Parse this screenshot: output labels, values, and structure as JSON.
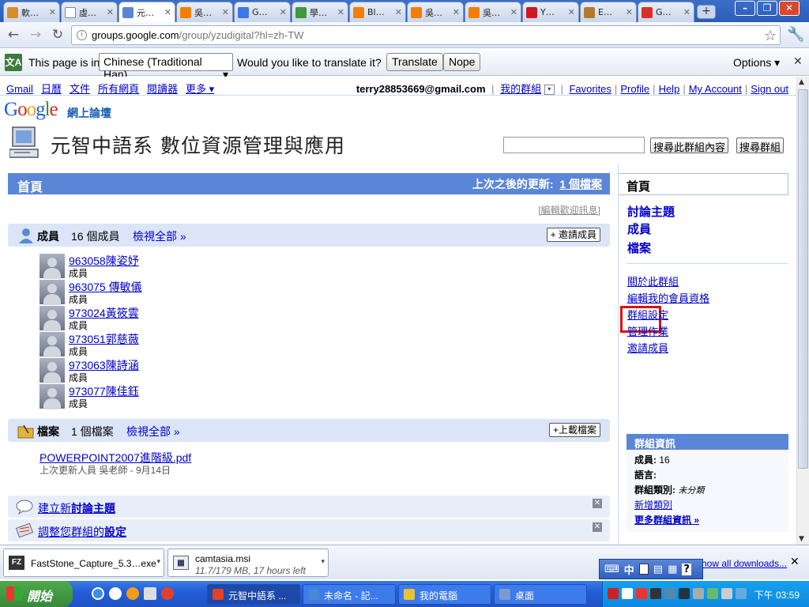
{
  "tabs": [
    {
      "label": "軟…",
      "favicon": "star-icon",
      "color": "#d98c2b"
    },
    {
      "label": "虛…",
      "favicon": "page-icon",
      "color": "#ffffff"
    },
    {
      "label": "元…",
      "favicon": "groups-icon",
      "color": "#5b86d7",
      "active": true
    },
    {
      "label": "吳…",
      "favicon": "blogger-icon",
      "color": "#f57d00"
    },
    {
      "label": "G…",
      "favicon": "google-docs-icon",
      "color": "#3b78e7"
    },
    {
      "label": "學…",
      "favicon": "spreadsheet-icon",
      "color": "#3b9a3b"
    },
    {
      "label": "Bl…",
      "favicon": "blogger-icon",
      "color": "#f57d00"
    },
    {
      "label": "吳…",
      "favicon": "blogger-icon",
      "color": "#f57d00"
    },
    {
      "label": "吳…",
      "favicon": "blogger-icon",
      "color": "#f57d00"
    },
    {
      "label": "Y…",
      "favicon": "youtube-icon",
      "color": "#cc181e"
    },
    {
      "label": "E…",
      "favicon": "bookmark-icon",
      "color": "#b07a2e"
    },
    {
      "label": "G…",
      "favicon": "gmail-icon",
      "color": "#d93025"
    }
  ],
  "url": {
    "host": "groups.google.com",
    "path": "/group/yzudigital?hl=zh-TW"
  },
  "translate": {
    "prefix": "This page is in",
    "language": "Chinese (Traditional Han)",
    "question": "Would you like to translate it?",
    "translate_label": "Translate",
    "nope_label": "Nope",
    "options_label": "Options ▾"
  },
  "gbar": {
    "left": [
      "Gmail",
      "日曆",
      "文件",
      "所有網頁",
      "閱讀器",
      "更多 ▾"
    ],
    "email": "terry28853669@gmail.com",
    "my_groups": "我的群組",
    "right": [
      "Favorites",
      "Profile",
      "Help",
      "My Account",
      "Sign out"
    ]
  },
  "logo_sub": "網上論壇",
  "group_title": "元智中語系 數位資源管理與應用",
  "search": {
    "in_group_label": "搜尋此群組內容",
    "groups_label": "搜尋群組"
  },
  "home": {
    "title": "首頁",
    "since_label": "上次之後的更新:",
    "since_link": "1 個檔案"
  },
  "edit_welcome": "[編輯歡迎訊息]",
  "members_section": {
    "title": "成員",
    "count": "16 個成員",
    "view_all": "檢視全部 »",
    "invite": "+ 邀請成員"
  },
  "members": [
    {
      "name": "963058陳姿妤",
      "role": "成員"
    },
    {
      "name": "963075 傳敏儀",
      "role": "成員"
    },
    {
      "name": "973024黃筱雲",
      "role": "成員"
    },
    {
      "name": "973051郭慈薇",
      "role": "成員"
    },
    {
      "name": "973063陳詩涵",
      "role": "成員"
    },
    {
      "name": "973077陳佳鈺",
      "role": "成員"
    }
  ],
  "files_section": {
    "title": "檔案",
    "count": "1 個檔案",
    "view_all": "檢視全部 »",
    "upload": "+上載檔案"
  },
  "file": {
    "name": "POWERPOINT2007進階級.pdf",
    "meta": "上次更新人員 吳老師 - 9月14日"
  },
  "tips": [
    {
      "prefix": "建立新",
      "bold": "討論主題"
    },
    {
      "prefix": "調整您群組的",
      "bold": "設定"
    }
  ],
  "right_nav": {
    "home": "首頁",
    "discussions": "討論主題",
    "members": "成員",
    "files": "檔案",
    "links": [
      "關於此群組",
      "編輯我的會員資格",
      "群組設定",
      "管理作業",
      "邀請成員"
    ]
  },
  "group_info": {
    "header": "群組資訊",
    "members_label": "成員:",
    "members_value": "16",
    "language_label": "語言:",
    "category_label": "群組類別:",
    "category_value": "未分類",
    "add_category": "新增類別",
    "more": "更多群組資訊 »"
  },
  "downloads": [
    {
      "name": "FastStone_Capture_5.3…exe",
      "sub": "",
      "icon": "fz-icon"
    },
    {
      "name": "camtasia.msi",
      "sub": "11.7/179 MB, 17 hours left",
      "icon": "installer-icon"
    }
  ],
  "show_all_downloads": "Show all downloads...",
  "ime": {
    "mode": "中"
  },
  "taskbar": {
    "start": "開始",
    "items": [
      {
        "label": "元智中語系 ...",
        "active": true
      },
      {
        "label": "未命名 - 記..."
      },
      {
        "label": "我的電腦"
      },
      {
        "label": "桌面"
      }
    ],
    "clock": "下午 03:59"
  },
  "colors": {
    "accent": "#5b86d7",
    "section": "#dbe5f7",
    "link": "#0000cc",
    "highlight": "#dd1111"
  }
}
